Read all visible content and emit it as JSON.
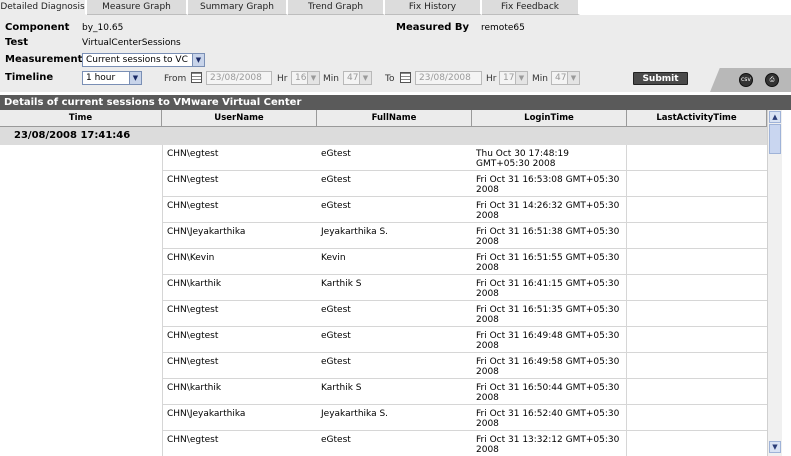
{
  "tabs": [
    {
      "label": "Detailed Diagnosis",
      "active": true
    },
    {
      "label": "Measure Graph",
      "active": false
    },
    {
      "label": "Summary Graph",
      "active": false
    },
    {
      "label": "Trend Graph",
      "active": false
    },
    {
      "label": "Fix History",
      "active": false
    },
    {
      "label": "Fix Feedback",
      "active": false
    }
  ],
  "info": {
    "component_label": "Component",
    "component_value": "by_10.65",
    "measured_by_label": "Measured By",
    "measured_by_value": "remote65",
    "test_label": "Test",
    "test_value": "VirtualCenterSessions",
    "measurement_label": "Measurement",
    "measurement_value": "Current sessions to VC",
    "timeline_label": "Timeline",
    "timeline_value": "1 hour",
    "from_label": "From",
    "from_date": "23/08/2008",
    "to_label": "To",
    "to_date": "23/08/2008",
    "hr_label": "Hr",
    "min_label": "Min",
    "from_hr": "16",
    "from_min": "47",
    "to_hr": "17",
    "to_min": "47",
    "submit_label": "Submit"
  },
  "icons": {
    "csv": "csv-icon",
    "print": "print-icon"
  },
  "section_title": "Details of current sessions to VMware Virtual Center",
  "columns": [
    "Time",
    "UserName",
    "FullName",
    "LoginTime",
    "LastActivityTime"
  ],
  "group_time": "23/08/2008 17:41:46",
  "rows": [
    {
      "user": "CHN\\egtest",
      "full": "eGtest",
      "login": "Thu Oct 30 17:48:19 GMT+05:30 2008",
      "last": ""
    },
    {
      "user": "CHN\\egtest",
      "full": "eGtest",
      "login": "Fri Oct 31 16:53:08 GMT+05:30 2008",
      "last": ""
    },
    {
      "user": "CHN\\egtest",
      "full": "eGtest",
      "login": "Fri Oct 31 14:26:32 GMT+05:30 2008",
      "last": ""
    },
    {
      "user": "CHN\\Jeyakarthika",
      "full": "Jeyakarthika S.",
      "login": "Fri Oct 31 16:51:38 GMT+05:30 2008",
      "last": ""
    },
    {
      "user": "CHN\\Kevin",
      "full": "Kevin",
      "login": "Fri Oct 31 16:51:55 GMT+05:30 2008",
      "last": ""
    },
    {
      "user": "CHN\\karthik",
      "full": "Karthik S",
      "login": "Fri Oct 31 16:41:15 GMT+05:30 2008",
      "last": ""
    },
    {
      "user": "CHN\\egtest",
      "full": "eGtest",
      "login": "Fri Oct 31 16:51:35 GMT+05:30 2008",
      "last": ""
    },
    {
      "user": "CHN\\egtest",
      "full": "eGtest",
      "login": "Fri Oct 31 16:49:48 GMT+05:30 2008",
      "last": ""
    },
    {
      "user": "CHN\\egtest",
      "full": "eGtest",
      "login": "Fri Oct 31 16:49:58 GMT+05:30 2008",
      "last": ""
    },
    {
      "user": "CHN\\karthik",
      "full": "Karthik S",
      "login": "Fri Oct 31 16:50:44 GMT+05:30 2008",
      "last": ""
    },
    {
      "user": "CHN\\Jeyakarthika",
      "full": "Jeyakarthika S.",
      "login": "Fri Oct 31 16:52:40 GMT+05:30 2008",
      "last": ""
    },
    {
      "user": "CHN\\egtest",
      "full": "eGtest",
      "login": "Fri Oct 31 13:32:12 GMT+05:30 2008",
      "last": ""
    }
  ]
}
